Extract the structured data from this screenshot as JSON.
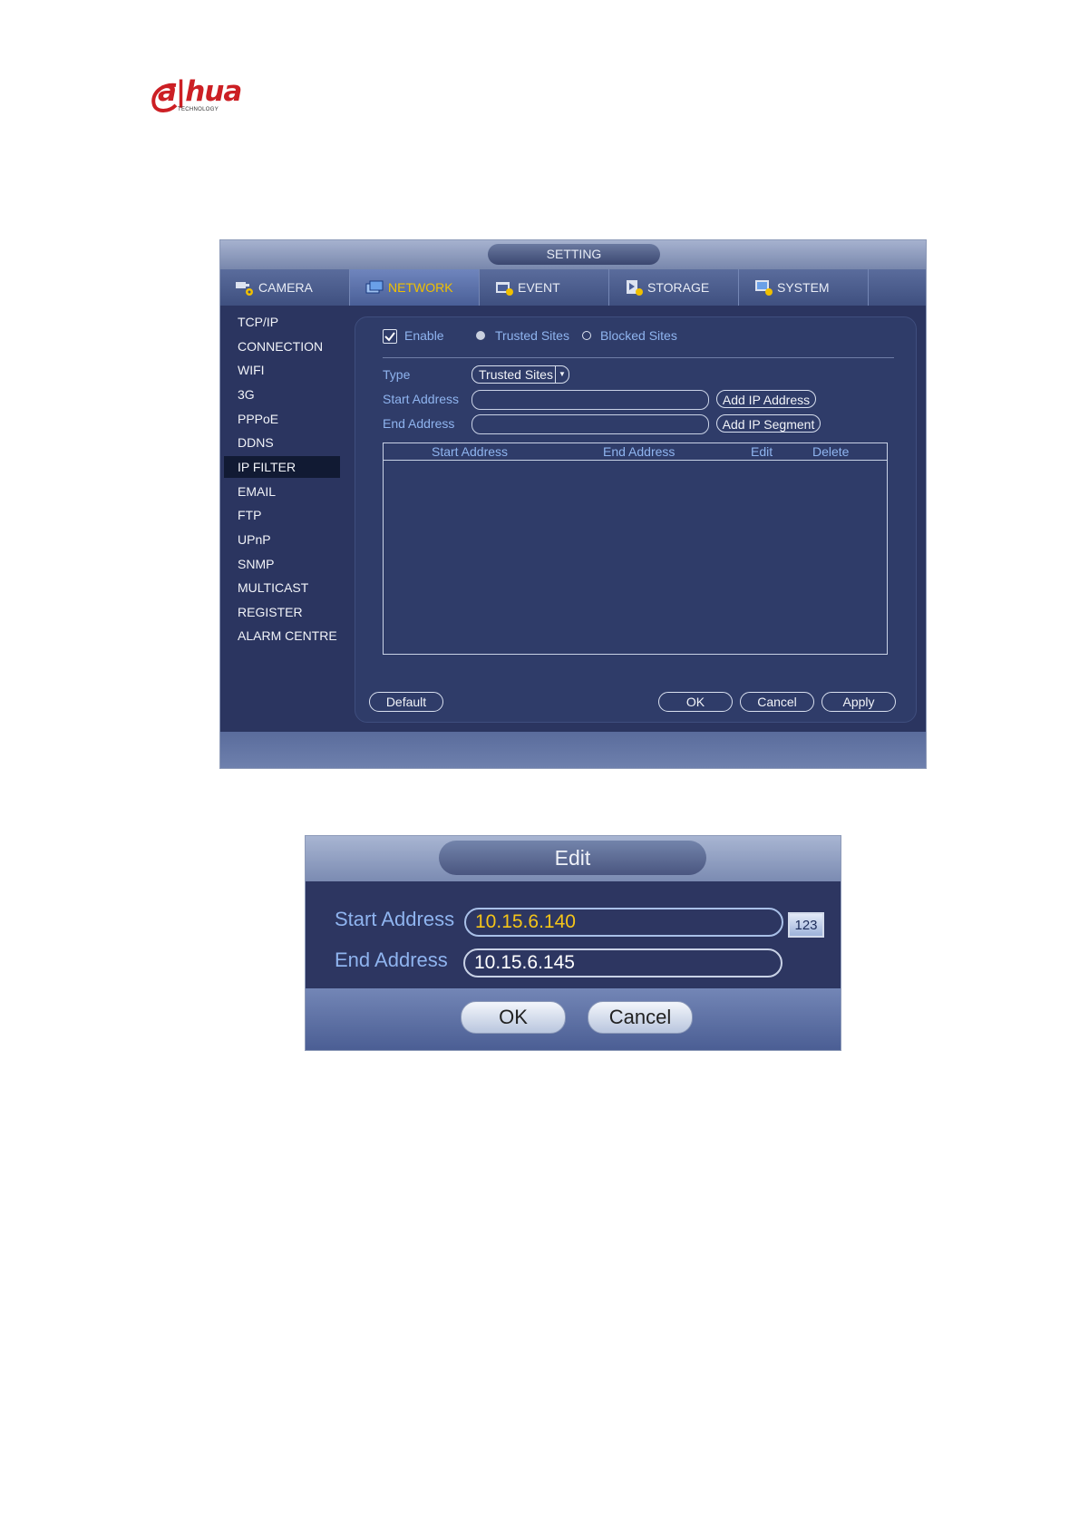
{
  "logo": {
    "brand_a": "a",
    "brand_rest": "hua",
    "sub": "TECHNOLOGY",
    "color": "#cc1f24"
  },
  "setting": {
    "title": "SETTING",
    "tabs": [
      {
        "label": "CAMERA",
        "icon": "camera-gear-icon"
      },
      {
        "label": "NETWORK",
        "icon": "network-icon",
        "active": true
      },
      {
        "label": "EVENT",
        "icon": "event-icon"
      },
      {
        "label": "STORAGE",
        "icon": "storage-icon"
      },
      {
        "label": "SYSTEM",
        "icon": "system-icon"
      }
    ],
    "sidebar": [
      "TCP/IP",
      "CONNECTION",
      "WIFI",
      "3G",
      "PPPoE",
      "DDNS",
      "IP FILTER",
      "EMAIL",
      "FTP",
      "UPnP",
      "SNMP",
      "MULTICAST",
      "REGISTER",
      "ALARM CENTRE"
    ],
    "active_sidebar": "IP FILTER",
    "enable_label": "Enable",
    "trusted_label": "Trusted Sites",
    "blocked_label": "Blocked Sites",
    "type_label": "Type",
    "type_value": "Trusted Sites",
    "start_label": "Start Address",
    "end_label": "End Address",
    "add_ip_address": "Add IP Address",
    "add_ip_segment": "Add IP Segment",
    "table_headers": [
      "Start Address",
      "End Address",
      "Edit",
      "Delete"
    ],
    "default_btn": "Default",
    "ok_btn": "OK",
    "cancel_btn": "Cancel",
    "apply_btn": "Apply",
    "accent": "#f0c000",
    "label_color": "#8fb4ef"
  },
  "edit": {
    "title": "Edit",
    "start_label": "Start Address",
    "start_value": "10.15.6.140",
    "end_label": "End Address",
    "end_value": "10.15.6.145",
    "keyboard_label": "123",
    "ok_btn": "OK",
    "cancel_btn": "Cancel",
    "active_value_color": "#f5c518"
  }
}
